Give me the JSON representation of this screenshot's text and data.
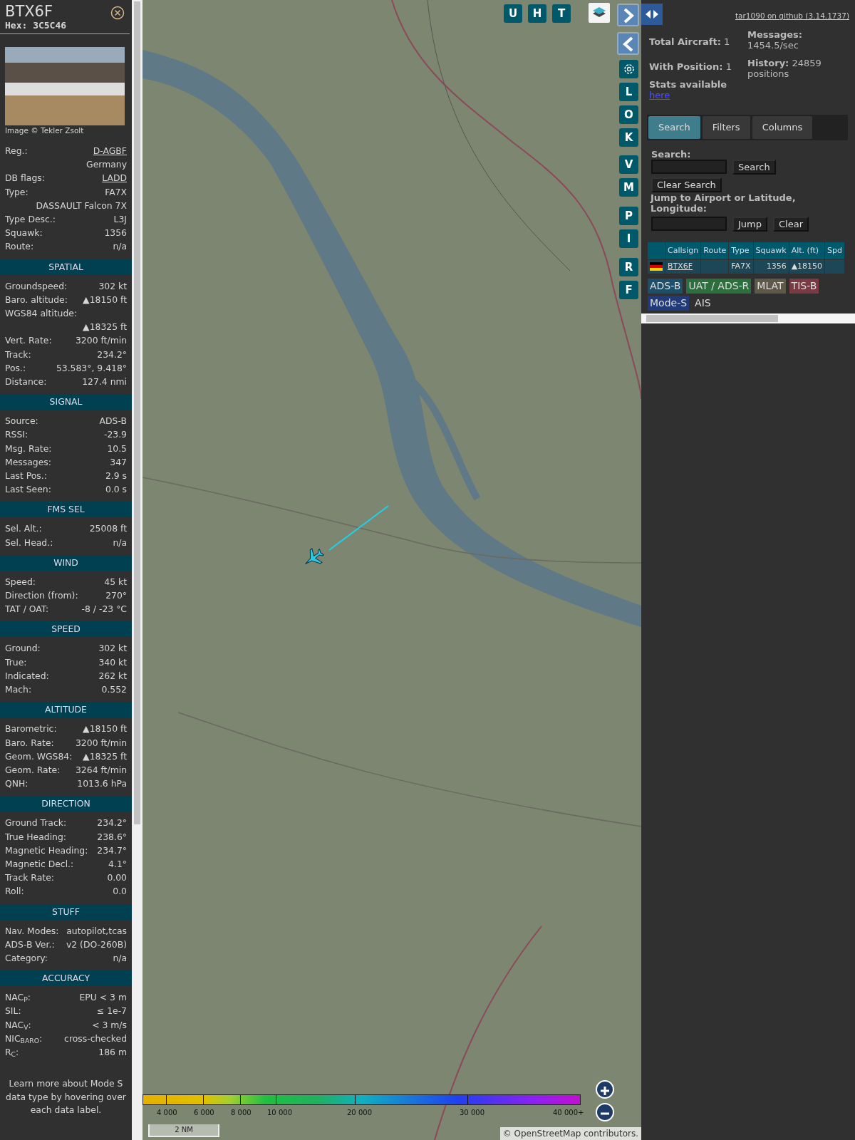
{
  "sidebar": {
    "title": "BTX6F",
    "hex": "Hex: 3C5C46",
    "photo_credit": "Image © Tekler Zsolt",
    "rows": [
      {
        "label": "Reg.:",
        "value": "D-AGBF",
        "kind": "link"
      },
      {
        "value": "Germany",
        "kind": "value_only"
      },
      {
        "label": "DB flags:",
        "value": "LADD",
        "kind": "link"
      },
      {
        "label": "Type:",
        "value": "FA7X",
        "kind": "plain"
      },
      {
        "value": "DASSAULT Falcon 7X",
        "kind": "value_only"
      },
      {
        "label": "Type Desc.:",
        "value": "L3J",
        "kind": "plain"
      },
      {
        "label": "Squawk:",
        "value": "1356",
        "kind": "plain"
      },
      {
        "label": "Route:",
        "value": "n/a",
        "kind": "plain"
      }
    ],
    "sections": [
      {
        "heading": "SPATIAL",
        "rows": [
          {
            "label": "Groundspeed:",
            "value": "302 kt",
            "kind": "plain"
          },
          {
            "label": "Baro. altitude:",
            "value": "▲18150 ft",
            "kind": "plain"
          },
          {
            "label": "WGS84 altitude:",
            "value": "▲18325 ft",
            "kind": "wrap"
          },
          {
            "label": "Vert. Rate:",
            "value": "3200 ft/min",
            "kind": "plain"
          },
          {
            "label": "Track:",
            "value": "234.2°",
            "kind": "plain"
          },
          {
            "label": "Pos.:",
            "value": "53.583°, 9.418°",
            "kind": "plain"
          },
          {
            "label": "Distance:",
            "value": "127.4 nmi",
            "kind": "plain"
          }
        ]
      },
      {
        "heading": "SIGNAL",
        "rows": [
          {
            "label": "Source:",
            "value": "ADS-B",
            "kind": "plain"
          },
          {
            "label": "RSSI:",
            "value": "-23.9",
            "kind": "plain"
          },
          {
            "label": "Msg. Rate:",
            "value": "10.5",
            "kind": "plain"
          },
          {
            "label": "Messages:",
            "value": "347",
            "kind": "plain"
          },
          {
            "label": "Last Pos.:",
            "value": "2.9 s",
            "kind": "plain"
          },
          {
            "label": "Last Seen:",
            "value": "0.0 s",
            "kind": "plain"
          }
        ]
      },
      {
        "heading": "FMS SEL",
        "rows": [
          {
            "label": "Sel. Alt.:",
            "value": "25008 ft",
            "kind": "plain"
          },
          {
            "label": "Sel. Head.:",
            "value": "n/a",
            "kind": "plain"
          }
        ]
      },
      {
        "heading": "WIND",
        "rows": [
          {
            "label": "Speed:",
            "value": "45 kt",
            "kind": "plain"
          },
          {
            "label": "Direction (from):",
            "value": "270°",
            "kind": "plain"
          },
          {
            "label": "TAT / OAT:",
            "value": "-8 / -23 °C",
            "kind": "plain"
          }
        ]
      },
      {
        "heading": "SPEED",
        "rows": [
          {
            "label": "Ground:",
            "value": "302 kt",
            "kind": "plain"
          },
          {
            "label": "True:",
            "value": "340 kt",
            "kind": "plain"
          },
          {
            "label": "Indicated:",
            "value": "262 kt",
            "kind": "plain"
          },
          {
            "label": "Mach:",
            "value": "0.552",
            "kind": "plain"
          }
        ]
      },
      {
        "heading": "ALTITUDE",
        "rows": [
          {
            "label": "Barometric:",
            "value": "▲18150 ft",
            "kind": "plain"
          },
          {
            "label": "Baro. Rate:",
            "value": "3200 ft/min",
            "kind": "plain"
          },
          {
            "label": "Geom. WGS84:",
            "value": "▲18325 ft",
            "kind": "plain"
          },
          {
            "label": "Geom. Rate:",
            "value": "3264 ft/min",
            "kind": "plain"
          },
          {
            "label": "QNH:",
            "value": "1013.6 hPa",
            "kind": "plain"
          }
        ]
      },
      {
        "heading": "DIRECTION",
        "rows": [
          {
            "label": "Ground Track:",
            "value": "234.2°",
            "kind": "plain"
          },
          {
            "label": "True Heading:",
            "value": "238.6°",
            "kind": "plain"
          },
          {
            "label": "Magnetic Heading:",
            "value": "234.7°",
            "kind": "plain"
          },
          {
            "label": "Magnetic Decl.:",
            "value": "4.1°",
            "kind": "plain"
          },
          {
            "label": "Track Rate:",
            "value": "0.00",
            "kind": "plain"
          },
          {
            "label": "Roll:",
            "value": "0.0",
            "kind": "plain"
          }
        ]
      },
      {
        "heading": "STUFF",
        "rows": [
          {
            "label": "Nav. Modes:",
            "value": "autopilot,tcas",
            "kind": "plain"
          },
          {
            "label": "ADS-B Ver.:",
            "value": "v2 (DO-260B)",
            "kind": "plain"
          },
          {
            "label": "Category:",
            "value": "n/a",
            "kind": "plain"
          }
        ]
      },
      {
        "heading": "ACCURACY",
        "rows": [
          {
            "label": "NAC$_{P}$:",
            "value": "EPU < 3 m",
            "kind": "plain"
          },
          {
            "label": "SIL:",
            "value": "≤ 1e-7",
            "kind": "plain"
          },
          {
            "label": "NAC$_{V}$:",
            "value": "< 3 m/s",
            "kind": "plain"
          },
          {
            "label": "NIC$_{BARO}$:",
            "value": "cross-checked",
            "kind": "plain"
          },
          {
            "label": "R$_{C}$:",
            "value": "186 m",
            "kind": "plain"
          }
        ]
      }
    ],
    "footnote": "Learn more about Mode S data type by hovering over each data label."
  },
  "map": {
    "top_buttons": [
      "U",
      "H",
      "T"
    ],
    "side_groups": [
      [
        "L",
        "O",
        "K"
      ],
      [
        "V",
        "M"
      ],
      [
        "P",
        "I"
      ],
      [
        "R",
        "F"
      ]
    ],
    "legend_ticks": [
      "4 000",
      "6 000",
      "8 000",
      "10 000",
      "20 000",
      "30 000",
      "40 000+"
    ],
    "scale": "2 NM",
    "attribution": "© OpenStreetMap contributors."
  },
  "panel": {
    "github_link": "tar1090 on github (3.14.1737)",
    "stats_left": [
      "**Total Aircraft:** 1",
      "**With Position:** 1"
    ],
    "stats_right": [
      "**Messages:** 1454.5/sec",
      "**History:** 24859 positions"
    ],
    "stats_note": "Stats available",
    "stats_link": "here",
    "tabs": [
      {
        "label": "Search",
        "selected": true
      },
      {
        "label": "Filters",
        "selected": false
      },
      {
        "label": "Columns",
        "selected": false
      }
    ],
    "search_label": "Search:",
    "search_button": "Search",
    "clear_search_button": "Clear Search",
    "jump_label": "Jump to Airport or Latitude, Longitude:",
    "jump_button": "Jump",
    "clear_button": "Clear",
    "table": {
      "columns": [
        "Callsign",
        "Route",
        "Type",
        "Squawk",
        "Alt. (ft)",
        "Spd"
      ],
      "rows": [
        {
          "callsign": "BTX6F",
          "type": "FA7X",
          "squawk": "1356",
          "altitude": "▲18150"
        }
      ]
    },
    "sources": [
      {
        "label": "ADS-B",
        "color": "#1d4f6a"
      },
      {
        "label": "UAT / ADS-R",
        "color": "#2c6e3c"
      },
      {
        "label": "MLAT",
        "color": "#5e5848"
      },
      {
        "label": "TIS-B",
        "color": "#7a3a44"
      },
      {
        "label": "Mode-S",
        "color": "#213b7a"
      },
      {
        "label": "AIS"
      }
    ]
  }
}
